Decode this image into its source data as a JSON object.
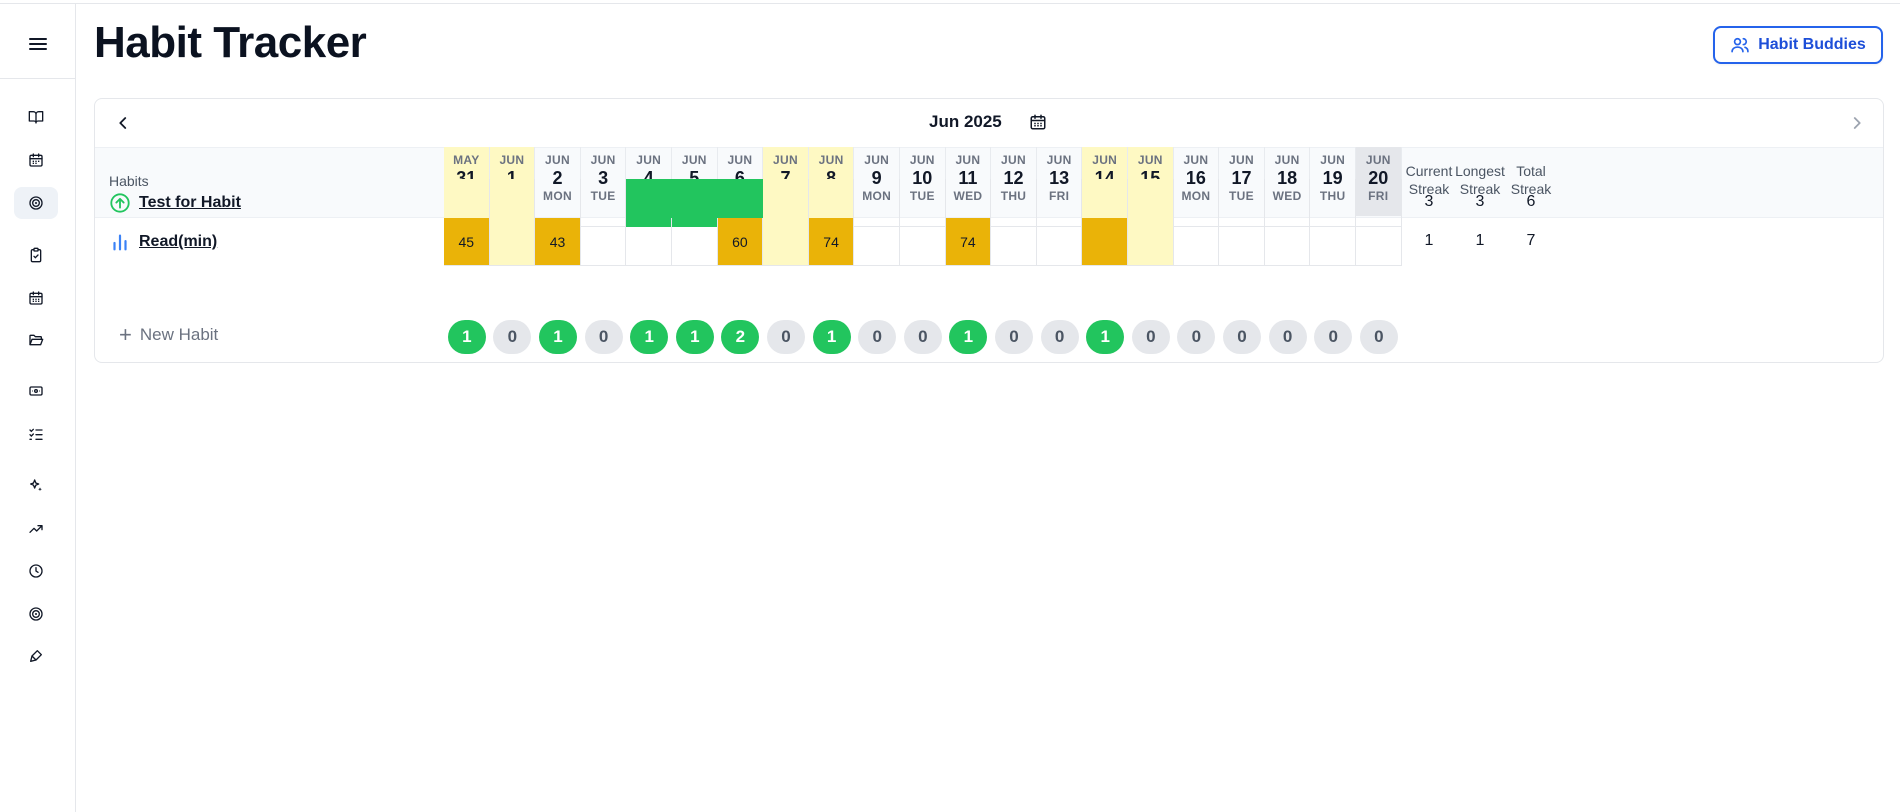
{
  "app": {
    "title": "Habit Tracker",
    "buddies_button": "Habit Buddies",
    "accent": "#2563eb"
  },
  "sidebar": {
    "items": [
      {
        "icon": "book-icon",
        "active": false
      },
      {
        "icon": "calendar-icon",
        "active": false
      },
      {
        "icon": "target-icon",
        "active": true
      },
      {
        "icon": "clipboard-check-icon",
        "active": false
      },
      {
        "icon": "calendar-days-icon",
        "active": false
      },
      {
        "icon": "folder-open-icon",
        "active": false
      },
      {
        "icon": "ticket-icon",
        "active": false
      },
      {
        "icon": "list-checks-icon",
        "active": false
      },
      {
        "icon": "sparkles-icon",
        "active": false
      },
      {
        "icon": "trending-up-icon",
        "active": false
      },
      {
        "icon": "clock-icon",
        "active": false
      },
      {
        "icon": "target-icon",
        "active": false
      },
      {
        "icon": "brush-icon",
        "active": false
      }
    ]
  },
  "tracker": {
    "month_label": "Jun 2025",
    "habits_header": "Habits",
    "stat_headers": [
      {
        "line1": "Current",
        "line2": "Streak"
      },
      {
        "line1": "Longest",
        "line2": "Streak"
      },
      {
        "line1": "Total",
        "line2": "Streak"
      }
    ],
    "days": [
      {
        "mon": "MAY",
        "num": "31",
        "dow": "SAT",
        "weekend": true
      },
      {
        "mon": "JUN",
        "num": "1",
        "dow": "SUN",
        "weekend": true
      },
      {
        "mon": "JUN",
        "num": "2",
        "dow": "MON"
      },
      {
        "mon": "JUN",
        "num": "3",
        "dow": "TUE"
      },
      {
        "mon": "JUN",
        "num": "4",
        "dow": "WED"
      },
      {
        "mon": "JUN",
        "num": "5",
        "dow": "THU"
      },
      {
        "mon": "JUN",
        "num": "6",
        "dow": "FRI"
      },
      {
        "mon": "JUN",
        "num": "7",
        "dow": "SAT",
        "weekend": true
      },
      {
        "mon": "JUN",
        "num": "8",
        "dow": "SUN",
        "weekend": true
      },
      {
        "mon": "JUN",
        "num": "9",
        "dow": "MON"
      },
      {
        "mon": "JUN",
        "num": "10",
        "dow": "TUE"
      },
      {
        "mon": "JUN",
        "num": "11",
        "dow": "WED"
      },
      {
        "mon": "JUN",
        "num": "12",
        "dow": "THU"
      },
      {
        "mon": "JUN",
        "num": "13",
        "dow": "FRI"
      },
      {
        "mon": "JUN",
        "num": "14",
        "dow": "SAT",
        "weekend": true
      },
      {
        "mon": "JUN",
        "num": "15",
        "dow": "SUN",
        "weekend": true
      },
      {
        "mon": "JUN",
        "num": "16",
        "dow": "MON"
      },
      {
        "mon": "JUN",
        "num": "17",
        "dow": "TUE"
      },
      {
        "mon": "JUN",
        "num": "18",
        "dow": "WED"
      },
      {
        "mon": "JUN",
        "num": "19",
        "dow": "THU"
      },
      {
        "mon": "JUN",
        "num": "20",
        "dow": "FRI",
        "today": true
      }
    ],
    "habits": [
      {
        "name": "Test for Habit",
        "icon": "arrow-up-circle-icon",
        "icon_color": "#22c55e",
        "cells": [
          "",
          "",
          "",
          "",
          "done",
          "done",
          "done",
          "",
          "",
          "",
          "",
          "",
          "",
          "",
          "",
          "",
          "",
          "",
          "",
          "",
          ""
        ],
        "current_streak": "3",
        "longest_streak": "3",
        "total_streak": "6"
      },
      {
        "name": "Read(min)",
        "icon": "bar-chart-icon",
        "icon_color": "#3b82f6",
        "cells": [
          "45",
          "",
          "43",
          "",
          "",
          "",
          "60",
          "",
          "74",
          "",
          "",
          "74",
          "",
          "",
          "amber",
          "",
          "",
          "",
          "",
          "",
          ""
        ],
        "current_streak": "1",
        "longest_streak": "1",
        "total_streak": "7"
      }
    ],
    "new_habit_label": "New Habit",
    "daily_counts": [
      "1",
      "0",
      "1",
      "0",
      "1",
      "1",
      "2",
      "0",
      "1",
      "0",
      "0",
      "1",
      "0",
      "0",
      "1",
      "0",
      "0",
      "0",
      "0",
      "0",
      "0"
    ],
    "colors": {
      "done_green": "#22c55e",
      "value_amber": "#eab308",
      "weekend_yellow": "#fef9c3",
      "today_gray": "#e5e7eb"
    }
  }
}
